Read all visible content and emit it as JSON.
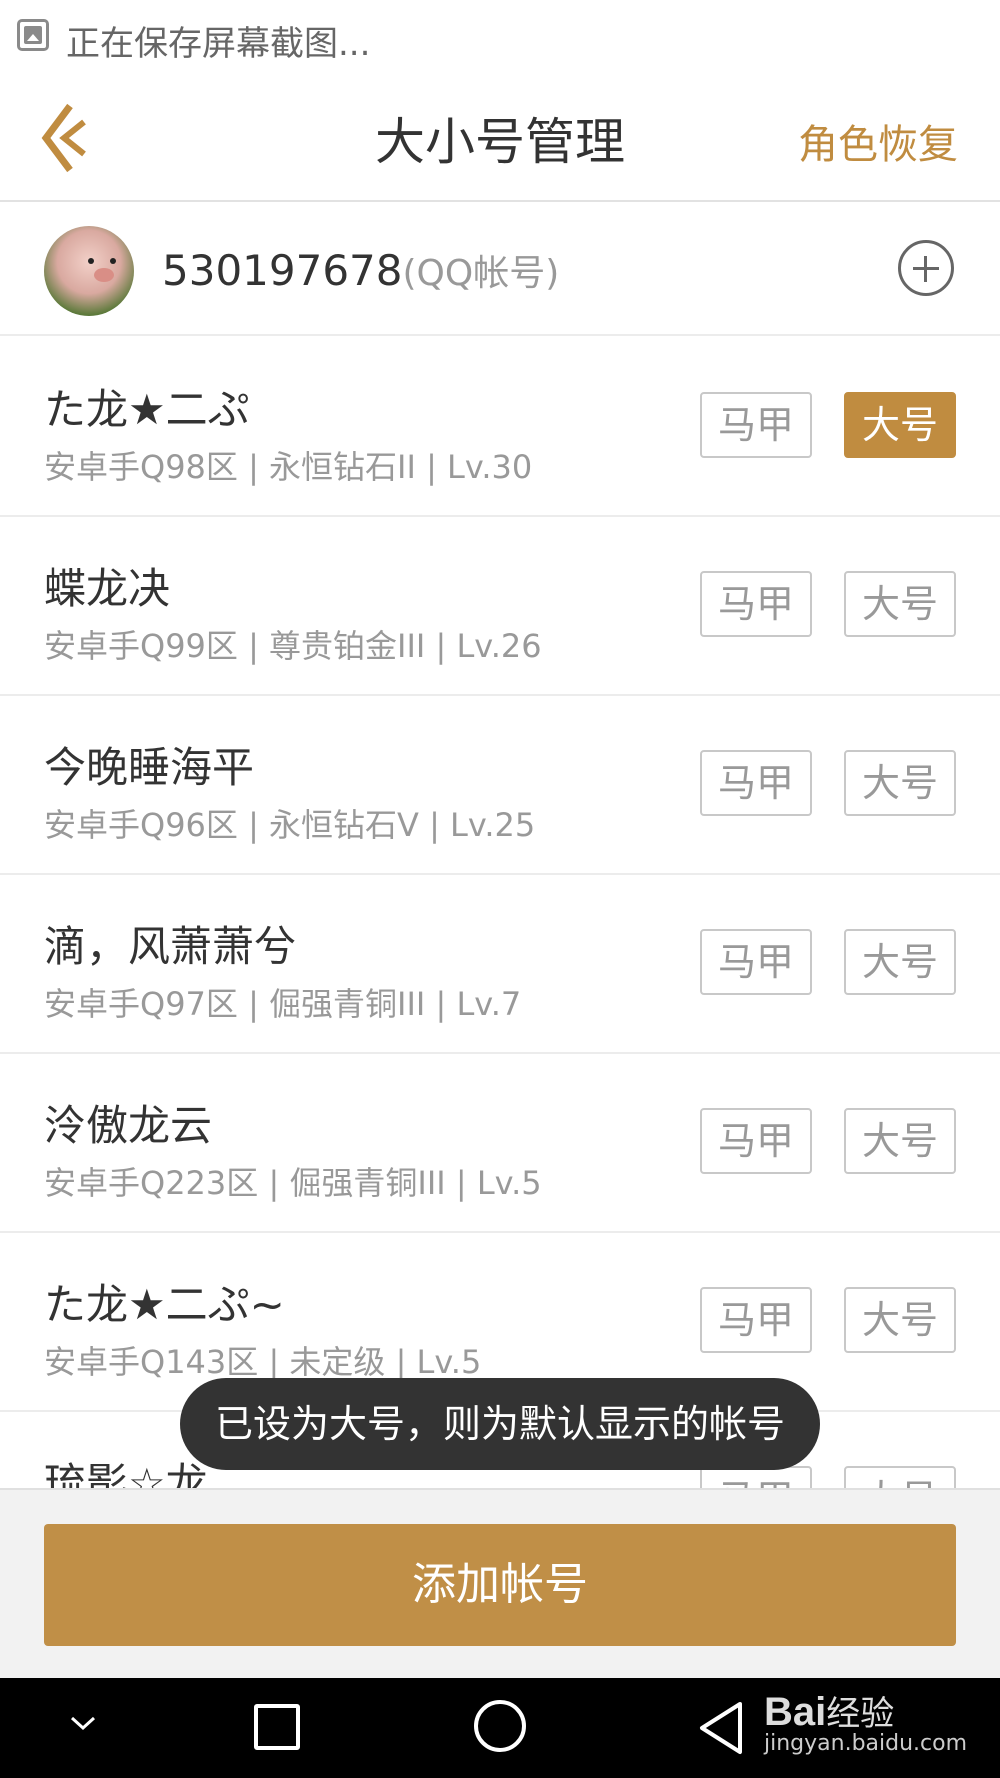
{
  "status_bar": {
    "text": "正在保存屏幕截图..."
  },
  "header": {
    "title": "大小号管理",
    "right_action": "角色恢复"
  },
  "account": {
    "number": "530197678",
    "type": "(QQ帐号)"
  },
  "roles": [
    {
      "name": "た龙★二ぷ",
      "info": "安卓手Q98区 | 永恒钻石II | Lv.30",
      "majia_label": "马甲",
      "dahao_label": "大号",
      "is_main": true
    },
    {
      "name": "蝶龙决",
      "info": "安卓手Q99区 | 尊贵铂金III | Lv.26",
      "majia_label": "马甲",
      "dahao_label": "大号",
      "is_main": false
    },
    {
      "name": "今晚睡海平",
      "info": "安卓手Q96区 | 永恒钻石V | Lv.25",
      "majia_label": "马甲",
      "dahao_label": "大号",
      "is_main": false
    },
    {
      "name": "滴，风萧萧兮",
      "info": "安卓手Q97区 | 倔强青铜III | Lv.7",
      "majia_label": "马甲",
      "dahao_label": "大号",
      "is_main": false
    },
    {
      "name": "泠傲龙云",
      "info": "安卓手Q223区 | 倔强青铜III | Lv.5",
      "majia_label": "马甲",
      "dahao_label": "大号",
      "is_main": false
    },
    {
      "name": "た龙★二ぷ~",
      "info": "安卓手Q143区 | 未定级 | Lv.5",
      "majia_label": "马甲",
      "dahao_label": "大号",
      "is_main": false
    },
    {
      "name": "琉影☆龙",
      "info": "",
      "majia_label": "马甲",
      "dahao_label": "大号",
      "is_main": false
    }
  ],
  "toast": "已设为大号，则为默认显示的帐号",
  "add_account_label": "添加帐号",
  "watermark": {
    "brand": "Bai",
    "cn": "经验",
    "url": "jingyan.baidu.com"
  },
  "colors": {
    "accent": "#c08c40",
    "toast_bg": "#333333",
    "nav_bg": "#000000"
  },
  "icons": {
    "back": "back-chevron-icon",
    "add": "plus-circle-icon",
    "status": "image-icon"
  }
}
